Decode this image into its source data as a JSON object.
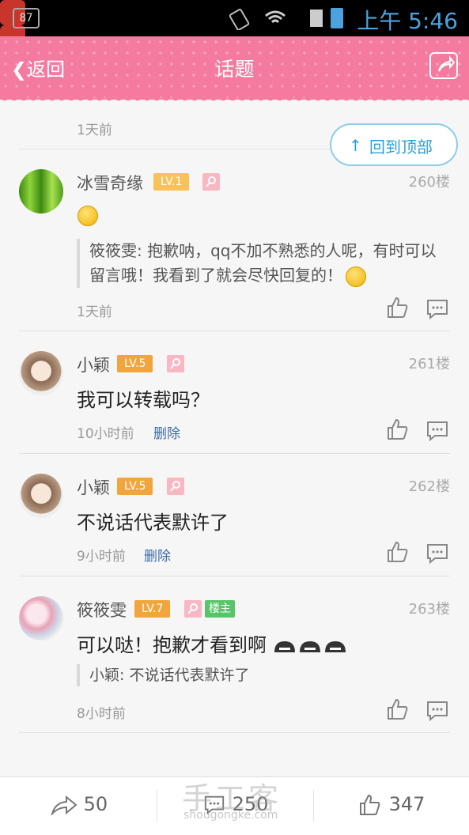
{
  "status_bar": {
    "notification_count": "87",
    "app_icon_3": "du",
    "time": "上午 5:46"
  },
  "nav": {
    "back_label": "返回",
    "title": "话题"
  },
  "float": {
    "to_top_label": "回到顶部"
  },
  "partial_post": {
    "time": "1天前"
  },
  "posts": [
    {
      "user": "冰雪奇缘",
      "level": "LV.1",
      "floor": "260楼",
      "quote": "筱筱雯: 抱歉呐，qq不加不熟悉的人呢，有时可以留言哦！我看到了就会尽快回复的！",
      "time": "1天前"
    },
    {
      "user": "小颖",
      "level": "LV.5",
      "floor": "261楼",
      "message": "我可以转载吗？",
      "time": "10小时前",
      "delete": "删除"
    },
    {
      "user": "小颖",
      "level": "LV.5",
      "floor": "262楼",
      "message": "不说话代表默许了",
      "time": "9小时前",
      "delete": "删除"
    },
    {
      "user": "筱筱雯",
      "level": "LV.7",
      "host": "楼主",
      "floor": "263楼",
      "message": "可以哒！抱歉才看到啊",
      "quote": "小颖: 不说话代表默许了",
      "time": "8小时前"
    }
  ],
  "bottom": {
    "shares": "50",
    "comments": "250",
    "likes": "347"
  },
  "watermark": {
    "text": "手工客",
    "url": "shougongke.com"
  },
  "colors": {
    "nav": "#f57aa0",
    "level_badge": "#f3a53d",
    "host_badge": "#59c56b",
    "link": "#3e6aa4"
  }
}
